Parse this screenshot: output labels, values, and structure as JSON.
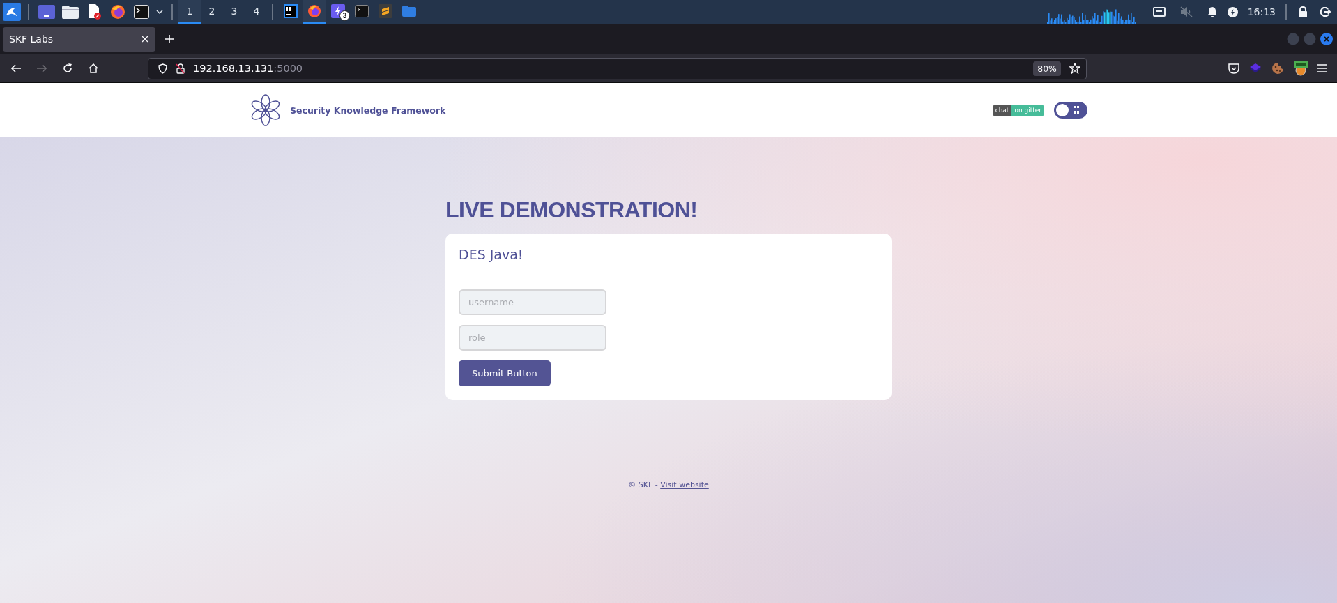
{
  "taskbar": {
    "workspaces": [
      {
        "label": "1",
        "selected": true
      },
      {
        "label": "2",
        "selected": false
      },
      {
        "label": "3",
        "selected": false
      },
      {
        "label": "4",
        "selected": false
      }
    ],
    "windows": [
      {
        "kind": "ide",
        "selected": false
      },
      {
        "kind": "browser",
        "selected": true
      },
      {
        "kind": "chat",
        "selected": false,
        "badge": "3"
      },
      {
        "kind": "terminal",
        "selected": false
      },
      {
        "kind": "editor",
        "selected": false
      },
      {
        "kind": "folder",
        "selected": false
      }
    ],
    "clock": "16:13"
  },
  "browser": {
    "tabs": [
      {
        "title": "SKF Labs",
        "selected": true
      }
    ],
    "forward_disabled": true,
    "url": {
      "host": "192.168.13.131",
      "port": ":5000"
    },
    "zoom": "80%"
  },
  "page": {
    "header": {
      "brand": "Security Knowledge Framework",
      "badge": {
        "left": "chat",
        "right": "on gitter"
      },
      "dark_mode": false
    },
    "heading": "LIVE DEMONSTRATION!",
    "card": {
      "title": "DES Java!",
      "fields": [
        {
          "placeholder": "username"
        },
        {
          "placeholder": "role"
        }
      ],
      "button": "Submit Button"
    },
    "footer": {
      "text": "© SKF - ",
      "link": "Visit website"
    }
  }
}
